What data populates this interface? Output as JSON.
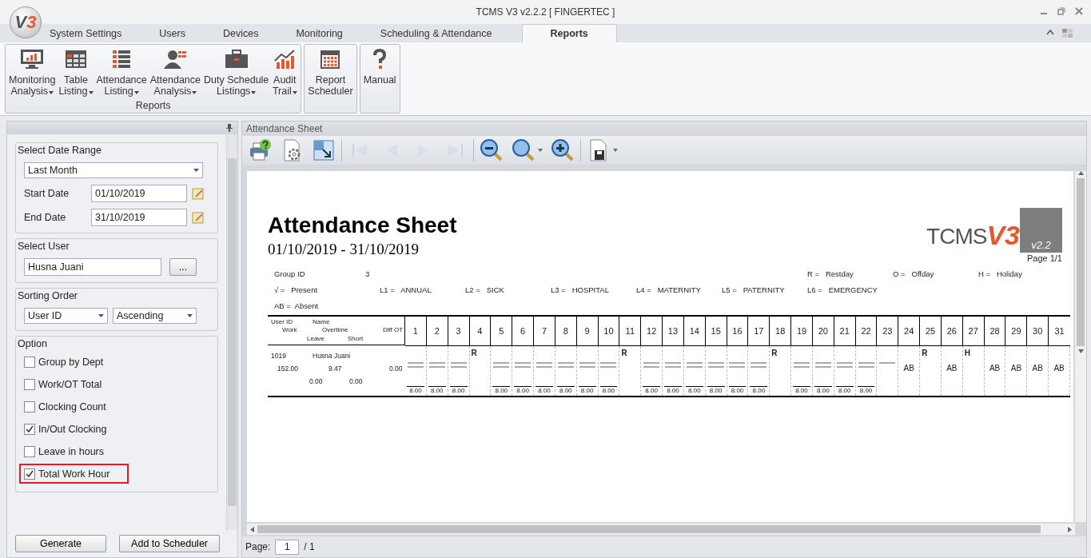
{
  "window": {
    "title": "TCMS V3 v2.2.2 [ FINGERTEC ]",
    "logo_letter": "V",
    "logo_digit": "3"
  },
  "tabs": [
    {
      "label": "System Settings",
      "selected": false
    },
    {
      "label": "Users",
      "selected": false
    },
    {
      "label": "Devices",
      "selected": false
    },
    {
      "label": "Monitoring",
      "selected": false
    },
    {
      "label": "Scheduling & Attendance",
      "selected": false
    },
    {
      "label": "Reports",
      "selected": true
    }
  ],
  "ribbon": [
    {
      "label": "Reports",
      "buttons": [
        {
          "kind": "monitor",
          "lines": [
            "Monitoring",
            "Analysis"
          ],
          "dropdown": true
        },
        {
          "kind": "table",
          "lines": [
            "Table",
            "Listing"
          ],
          "dropdown": true
        },
        {
          "kind": "list",
          "lines": [
            "Attendance",
            "Listing"
          ],
          "dropdown": true
        },
        {
          "kind": "person",
          "lines": [
            "Attendance",
            "Analysis"
          ],
          "dropdown": true
        },
        {
          "kind": "briefcase",
          "lines": [
            "Duty Schedule",
            "Listings"
          ],
          "dropdown": true
        },
        {
          "kind": "chart",
          "lines": [
            "Audit",
            "Trail"
          ],
          "dropdown": true
        }
      ]
    },
    {
      "buttons": [
        {
          "kind": "calendar",
          "lines": [
            "Report",
            "Scheduler"
          ],
          "dropdown": false
        }
      ]
    },
    {
      "buttons": [
        {
          "kind": "help",
          "lines": [
            "Manual"
          ],
          "dropdown": false
        }
      ]
    }
  ],
  "filters": {
    "date_range": {
      "title": "Select Date Range",
      "value": "Last Month",
      "start_label": "Start Date",
      "start": "01/10/2019",
      "end_label": "End Date",
      "end": "31/10/2019"
    },
    "user": {
      "title": "Select User",
      "value": "Husna Juani",
      "browse": "..."
    },
    "sorting": {
      "title": "Sorting Order",
      "field": "User ID",
      "order": "Ascending"
    },
    "option": {
      "title": "Option",
      "items": [
        {
          "label": "Group by Dept",
          "checked": false,
          "highlighted": false
        },
        {
          "label": "Work/OT Total",
          "checked": false,
          "highlighted": false
        },
        {
          "label": "Clocking Count",
          "checked": false,
          "highlighted": false
        },
        {
          "label": "In/Out Clocking",
          "checked": true,
          "highlighted": false
        },
        {
          "label": "Leave in hours",
          "checked": false,
          "highlighted": false
        },
        {
          "label": "Total Work Hour",
          "checked": true,
          "highlighted": true
        }
      ]
    },
    "buttons": [
      "Generate",
      "Add to Scheduler"
    ]
  },
  "viewer": {
    "title": "Attendance Sheet",
    "toolbar": [
      {
        "kind": "print",
        "disabled": false,
        "dropdown": false
      },
      {
        "kind": "setup",
        "disabled": false,
        "dropdown": false
      },
      {
        "kind": "export",
        "disabled": false,
        "dropdown": false
      },
      {
        "kind": "first",
        "disabled": true,
        "dropdown": false
      },
      {
        "kind": "prev",
        "disabled": true,
        "dropdown": false
      },
      {
        "kind": "next",
        "disabled": true,
        "dropdown": false
      },
      {
        "kind": "last",
        "disabled": true,
        "dropdown": false
      },
      {
        "kind": "zoom-out",
        "disabled": false,
        "dropdown": false
      },
      {
        "kind": "zoom",
        "disabled": false,
        "dropdown": true
      },
      {
        "kind": "zoom-in",
        "disabled": false,
        "dropdown": false
      },
      {
        "kind": "save",
        "disabled": false,
        "dropdown": true
      }
    ],
    "page_label": "Page:",
    "page": "1",
    "page_total": "/ 1"
  },
  "report": {
    "title": "Attendance Sheet",
    "period": "01/10/2019 - 31/10/2019",
    "logo": {
      "name": "TCMS",
      "version_mark": "V3",
      "version": "v2.2"
    },
    "page": "Page 1/1",
    "legend": {
      "group_label": "Group ID",
      "group_value": "3",
      "top_right": [
        {
          "code": "R =",
          "meaning": "Restday"
        },
        {
          "code": "O =",
          "meaning": "Offday"
        },
        {
          "code": "H =",
          "meaning": "Holiday"
        }
      ],
      "codes": [
        {
          "code": "√ =",
          "meaning": "Present"
        },
        {
          "code": "L1 =",
          "meaning": "ANNUAL"
        },
        {
          "code": "L2 =",
          "meaning": "SICK"
        },
        {
          "code": "L3 =",
          "meaning": "HOSPITAL"
        },
        {
          "code": "L4 =",
          "meaning": "MATERNITY"
        },
        {
          "code": "L5 =",
          "meaning": "PATERNITY"
        },
        {
          "code": "L6 =",
          "meaning": "EMERGENCY"
        }
      ],
      "absent": [
        {
          "code": "AB =",
          "meaning": "Absent"
        }
      ]
    },
    "header": {
      "user_id": "User ID",
      "name": "Name",
      "work": "Work",
      "overtime": "Overtime",
      "diff_ot": "Diff OT",
      "leave": "Leave",
      "short": "Short"
    },
    "row": {
      "user_id": "1019",
      "name": "Husna Juani",
      "work": "152.00",
      "overtime": "9.47",
      "diff_ot": "0.00",
      "leave": "0.00",
      "short": "0.00"
    },
    "days": [
      {
        "day": "1",
        "kind": "clocked",
        "hours": "8.00"
      },
      {
        "day": "2",
        "kind": "clocked",
        "hours": "8.00"
      },
      {
        "day": "3",
        "kind": "clocked",
        "hours": "8.00"
      },
      {
        "day": "4",
        "kind": "mark",
        "mark": "R"
      },
      {
        "day": "5",
        "kind": "clocked",
        "hours": "8.00"
      },
      {
        "day": "6",
        "kind": "clocked",
        "hours": "8.00"
      },
      {
        "day": "7",
        "kind": "clocked",
        "hours": "8.00"
      },
      {
        "day": "8",
        "kind": "clocked",
        "hours": "8.00"
      },
      {
        "day": "9",
        "kind": "clocked",
        "hours": "8.00"
      },
      {
        "day": "10",
        "kind": "clocked",
        "hours": "8.00"
      },
      {
        "day": "11",
        "kind": "mark",
        "mark": "R"
      },
      {
        "day": "12",
        "kind": "clocked",
        "hours": "8.00"
      },
      {
        "day": "13",
        "kind": "clocked",
        "hours": "8.00"
      },
      {
        "day": "14",
        "kind": "clocked",
        "hours": "8.00"
      },
      {
        "day": "15",
        "kind": "clocked",
        "hours": "8.00"
      },
      {
        "day": "16",
        "kind": "clocked",
        "hours": "8.00"
      },
      {
        "day": "17",
        "kind": "clocked",
        "hours": "8.00"
      },
      {
        "day": "18",
        "kind": "mark",
        "mark": "R"
      },
      {
        "day": "19",
        "kind": "clocked",
        "hours": "8.00"
      },
      {
        "day": "20",
        "kind": "clocked",
        "hours": "8.00"
      },
      {
        "day": "21",
        "kind": "clocked",
        "hours": "8.00"
      },
      {
        "day": "22",
        "kind": "clocked",
        "hours": "8.00"
      },
      {
        "day": "23",
        "kind": "clocked_in"
      },
      {
        "day": "24",
        "kind": "absent",
        "mark": "AB"
      },
      {
        "day": "25",
        "kind": "mark",
        "mark": "R"
      },
      {
        "day": "26",
        "kind": "absent",
        "mark": "AB"
      },
      {
        "day": "27",
        "kind": "mark",
        "mark": "H"
      },
      {
        "day": "28",
        "kind": "absent",
        "mark": "AB"
      },
      {
        "day": "29",
        "kind": "absent",
        "mark": "AB"
      },
      {
        "day": "30",
        "kind": "absent",
        "mark": "AB"
      },
      {
        "day": "31",
        "kind": "absent",
        "mark": "AB"
      }
    ]
  }
}
